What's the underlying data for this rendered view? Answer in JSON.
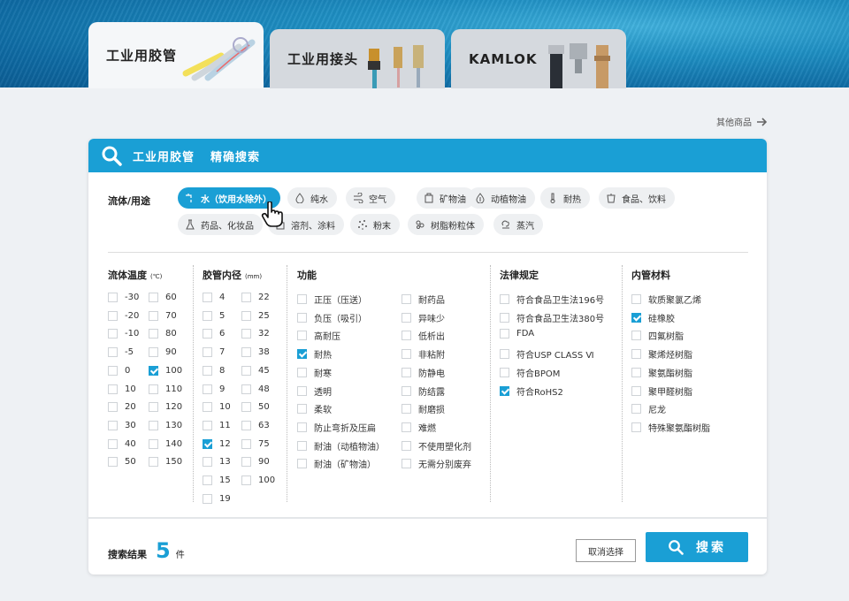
{
  "tabs": [
    {
      "label": "工业用胶管",
      "active": true
    },
    {
      "label": "工业用接头",
      "active": false
    },
    {
      "label": "KAMLOK",
      "active": false
    }
  ],
  "other_link": "其他商品",
  "header": {
    "title": "工业用胶管",
    "subtitle": "精确搜索"
  },
  "fluid": {
    "label": "流体/用途",
    "chips": [
      {
        "label": "水（饮用水除外）",
        "icon": "faucet-icon",
        "active": true
      },
      {
        "label": "纯水",
        "icon": "drop-icon"
      },
      {
        "label": "空气",
        "icon": "air-icon"
      },
      {
        "label": "矿物油",
        "icon": "oil-can-icon"
      },
      {
        "label": "动植物油",
        "icon": "plant-oil-icon"
      },
      {
        "label": "耐热",
        "icon": "thermometer-icon"
      },
      {
        "label": "食品、饮料",
        "icon": "cup-icon"
      },
      {
        "label": "药品、化妆品",
        "icon": "flask-icon"
      },
      {
        "label": "溶剂、涂料",
        "icon": "paint-icon"
      },
      {
        "label": "粉末",
        "icon": "powder-icon"
      },
      {
        "label": "树脂粉粒体",
        "icon": "granule-icon"
      },
      {
        "label": "蒸汽",
        "icon": "steam-icon"
      }
    ]
  },
  "temperature": {
    "title": "流体温度",
    "unit": "(℃)",
    "items": [
      {
        "label": "-30",
        "checked": false
      },
      {
        "label": "60",
        "checked": false
      },
      {
        "label": "-20",
        "checked": false
      },
      {
        "label": "70",
        "checked": false
      },
      {
        "label": "-10",
        "checked": false
      },
      {
        "label": "80",
        "checked": false
      },
      {
        "label": "-5",
        "checked": false
      },
      {
        "label": "90",
        "checked": false
      },
      {
        "label": "0",
        "checked": false
      },
      {
        "label": "100",
        "checked": true
      },
      {
        "label": "10",
        "checked": false
      },
      {
        "label": "110",
        "checked": false
      },
      {
        "label": "20",
        "checked": false
      },
      {
        "label": "120",
        "checked": false
      },
      {
        "label": "30",
        "checked": false
      },
      {
        "label": "130",
        "checked": false
      },
      {
        "label": "40",
        "checked": false
      },
      {
        "label": "140",
        "checked": false
      },
      {
        "label": "50",
        "checked": false
      },
      {
        "label": "150",
        "checked": false
      }
    ]
  },
  "diameter": {
    "title": "胶管内径",
    "unit": "(mm)",
    "items": [
      {
        "label": "4",
        "checked": false
      },
      {
        "label": "22",
        "checked": false
      },
      {
        "label": "5",
        "checked": false
      },
      {
        "label": "25",
        "checked": false
      },
      {
        "label": "6",
        "checked": false
      },
      {
        "label": "32",
        "checked": false
      },
      {
        "label": "7",
        "checked": false
      },
      {
        "label": "38",
        "checked": false
      },
      {
        "label": "8",
        "checked": false
      },
      {
        "label": "45",
        "checked": false
      },
      {
        "label": "9",
        "checked": false
      },
      {
        "label": "48",
        "checked": false
      },
      {
        "label": "10",
        "checked": false
      },
      {
        "label": "50",
        "checked": false
      },
      {
        "label": "11",
        "checked": false
      },
      {
        "label": "63",
        "checked": false
      },
      {
        "label": "12",
        "checked": true
      },
      {
        "label": "75",
        "checked": false
      },
      {
        "label": "13",
        "checked": false
      },
      {
        "label": "90",
        "checked": false
      },
      {
        "label": "15",
        "checked": false
      },
      {
        "label": "100",
        "checked": false
      },
      {
        "label": "19",
        "checked": false
      }
    ]
  },
  "function": {
    "title": "功能",
    "items": [
      {
        "label": "正压（压送）",
        "checked": false
      },
      {
        "label": "耐药品",
        "checked": false
      },
      {
        "label": "负压（吸引）",
        "checked": false
      },
      {
        "label": "异味少",
        "checked": false
      },
      {
        "label": "高耐压",
        "checked": false
      },
      {
        "label": "低析出",
        "checked": false
      },
      {
        "label": "耐热",
        "checked": true
      },
      {
        "label": "非粘附",
        "checked": false
      },
      {
        "label": "耐寒",
        "checked": false
      },
      {
        "label": "防静电",
        "checked": false
      },
      {
        "label": "透明",
        "checked": false
      },
      {
        "label": "防结露",
        "checked": false
      },
      {
        "label": "柔软",
        "checked": false
      },
      {
        "label": "耐磨损",
        "checked": false
      },
      {
        "label": "防止弯折及压扁",
        "checked": false
      },
      {
        "label": "难燃",
        "checked": false
      },
      {
        "label": "耐油（动植物油）",
        "checked": false
      },
      {
        "label": "不使用塑化剂",
        "checked": false
      },
      {
        "label": "耐油（矿物油）",
        "checked": false
      },
      {
        "label": "无需分别废弃",
        "checked": false
      }
    ]
  },
  "law": {
    "title": "法律规定",
    "items": [
      {
        "label": "符合食品卫生法196号",
        "checked": false
      },
      {
        "label": "符合食品卫生法380号",
        "checked": false
      },
      {
        "label": "FDA",
        "checked": false
      },
      {
        "label": "符合USP CLASS Ⅵ",
        "checked": false
      },
      {
        "label": "符合BPOM",
        "checked": false
      },
      {
        "label": "符合RoHS2",
        "checked": true
      }
    ]
  },
  "material": {
    "title": "内管材料",
    "items": [
      {
        "label": "软质聚氯乙烯",
        "checked": false
      },
      {
        "label": "硅橡胶",
        "checked": true
      },
      {
        "label": "四氟树脂",
        "checked": false
      },
      {
        "label": "聚烯烃树脂",
        "checked": false
      },
      {
        "label": "聚氨酯树脂",
        "checked": false
      },
      {
        "label": "聚甲醛树脂",
        "checked": false
      },
      {
        "label": "尼龙",
        "checked": false
      },
      {
        "label": "特殊聚氨酯树脂",
        "checked": false
      }
    ]
  },
  "footer": {
    "result_label": "搜索结果",
    "result_count": "5",
    "result_unit": "件",
    "clear_label": "取消选择",
    "search_label": "搜索"
  },
  "colors": {
    "accent": "#1a9fd5"
  }
}
